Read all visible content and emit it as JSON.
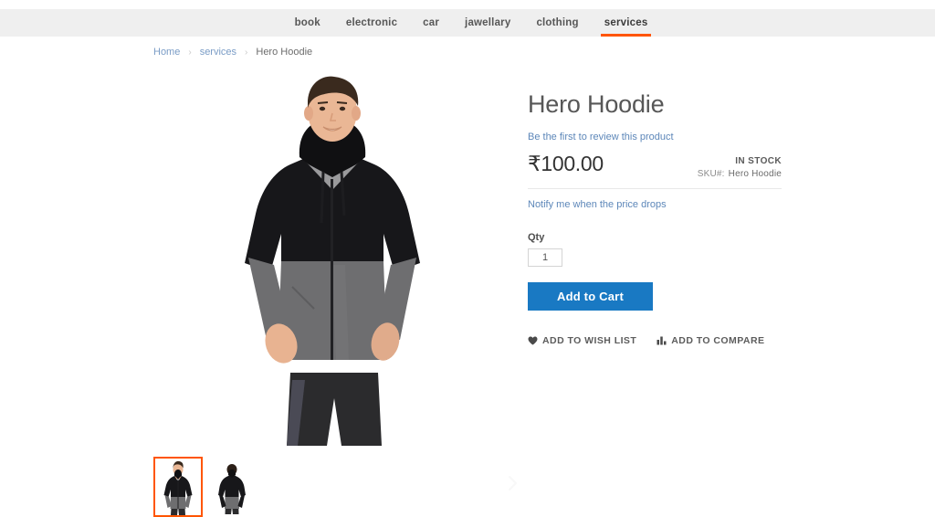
{
  "nav": {
    "items": [
      {
        "label": "book",
        "active": false
      },
      {
        "label": "electronic",
        "active": false
      },
      {
        "label": "car",
        "active": false
      },
      {
        "label": "jawellary",
        "active": false
      },
      {
        "label": "clothing",
        "active": false
      },
      {
        "label": "services",
        "active": true
      }
    ],
    "active_underline_color": "#ff5501",
    "background_color": "#efefef"
  },
  "breadcrumb": {
    "home": "Home",
    "category": "services",
    "current": "Hero Hoodie",
    "separator": "›"
  },
  "product": {
    "title": "Hero Hoodie",
    "review_link": "Be the first to review this product",
    "price": "₹100.00",
    "stock_status": "IN STOCK",
    "sku_label": "SKU#:",
    "sku_value": "Hero Hoodie",
    "notify_link": "Notify me when the price drops",
    "qty_label": "Qty",
    "qty_value": "1",
    "add_to_cart_label": "Add to Cart",
    "add_to_cart_color": "#1979c3",
    "wishlist_label": "ADD TO WISH LIST",
    "compare_label": "ADD TO COMPARE"
  },
  "gallery": {
    "main_alt": "Hero Hoodie front view on model",
    "next_icon": "chevron-right-icon",
    "thumbnails": [
      {
        "alt": "Hero Hoodie front view",
        "selected": true
      },
      {
        "alt": "Hero Hoodie back view",
        "selected": false
      }
    ]
  },
  "icons": {
    "wishlist": "heart-icon",
    "compare": "bar-chart-icon"
  }
}
